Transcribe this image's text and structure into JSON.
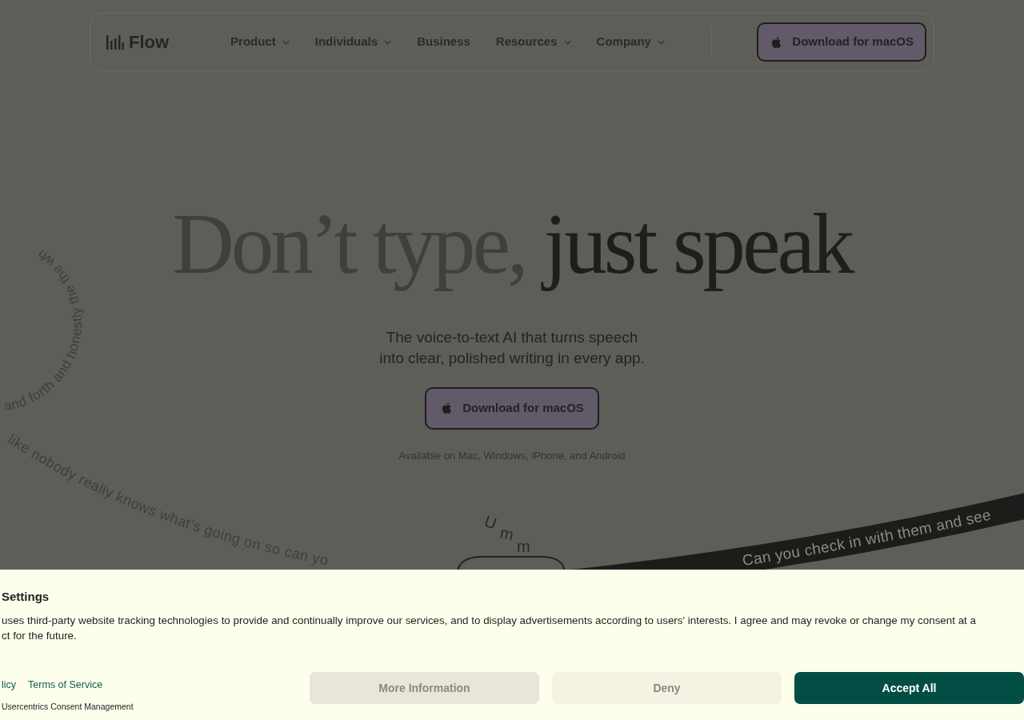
{
  "nav": {
    "logo": "Flow",
    "items": [
      {
        "label": "Product",
        "dropdown": true
      },
      {
        "label": "Individuals",
        "dropdown": true
      },
      {
        "label": "Business",
        "dropdown": false
      },
      {
        "label": "Resources",
        "dropdown": true
      },
      {
        "label": "Company",
        "dropdown": true
      }
    ],
    "cta": "Download for macOS"
  },
  "hero": {
    "title_light": "Don’t type,",
    "title_dark": "just speak",
    "subtitle": [
      "The voice-to-text AI that turns speech",
      "into clear, polished writing in every app."
    ],
    "cta": "Download for macOS",
    "availability": "Available on Mac, Windows, iPhone, and Android"
  },
  "floating_texts": {
    "circle": "and forth and honestly the the wh",
    "arc": "like nobody really knows what’s going on so can yo",
    "ribbon": "Can you check in with them and see",
    "filler": "Umm"
  },
  "consent": {
    "title": "Settings",
    "text": [
      "uses third-party website tracking technologies to provide and continually improve our services, and to display advertisements according to users' interests. I agree and may revoke or change my consent at a",
      "ct for the future."
    ],
    "links": [
      "licy",
      "Terms of Service"
    ],
    "powered_by": "Usercentrics Consent Management",
    "buttons": [
      {
        "label": "More Information",
        "kind": "secondary"
      },
      {
        "label": "Deny",
        "kind": "tertiary"
      },
      {
        "label": "Accept All",
        "kind": "primary"
      }
    ]
  }
}
